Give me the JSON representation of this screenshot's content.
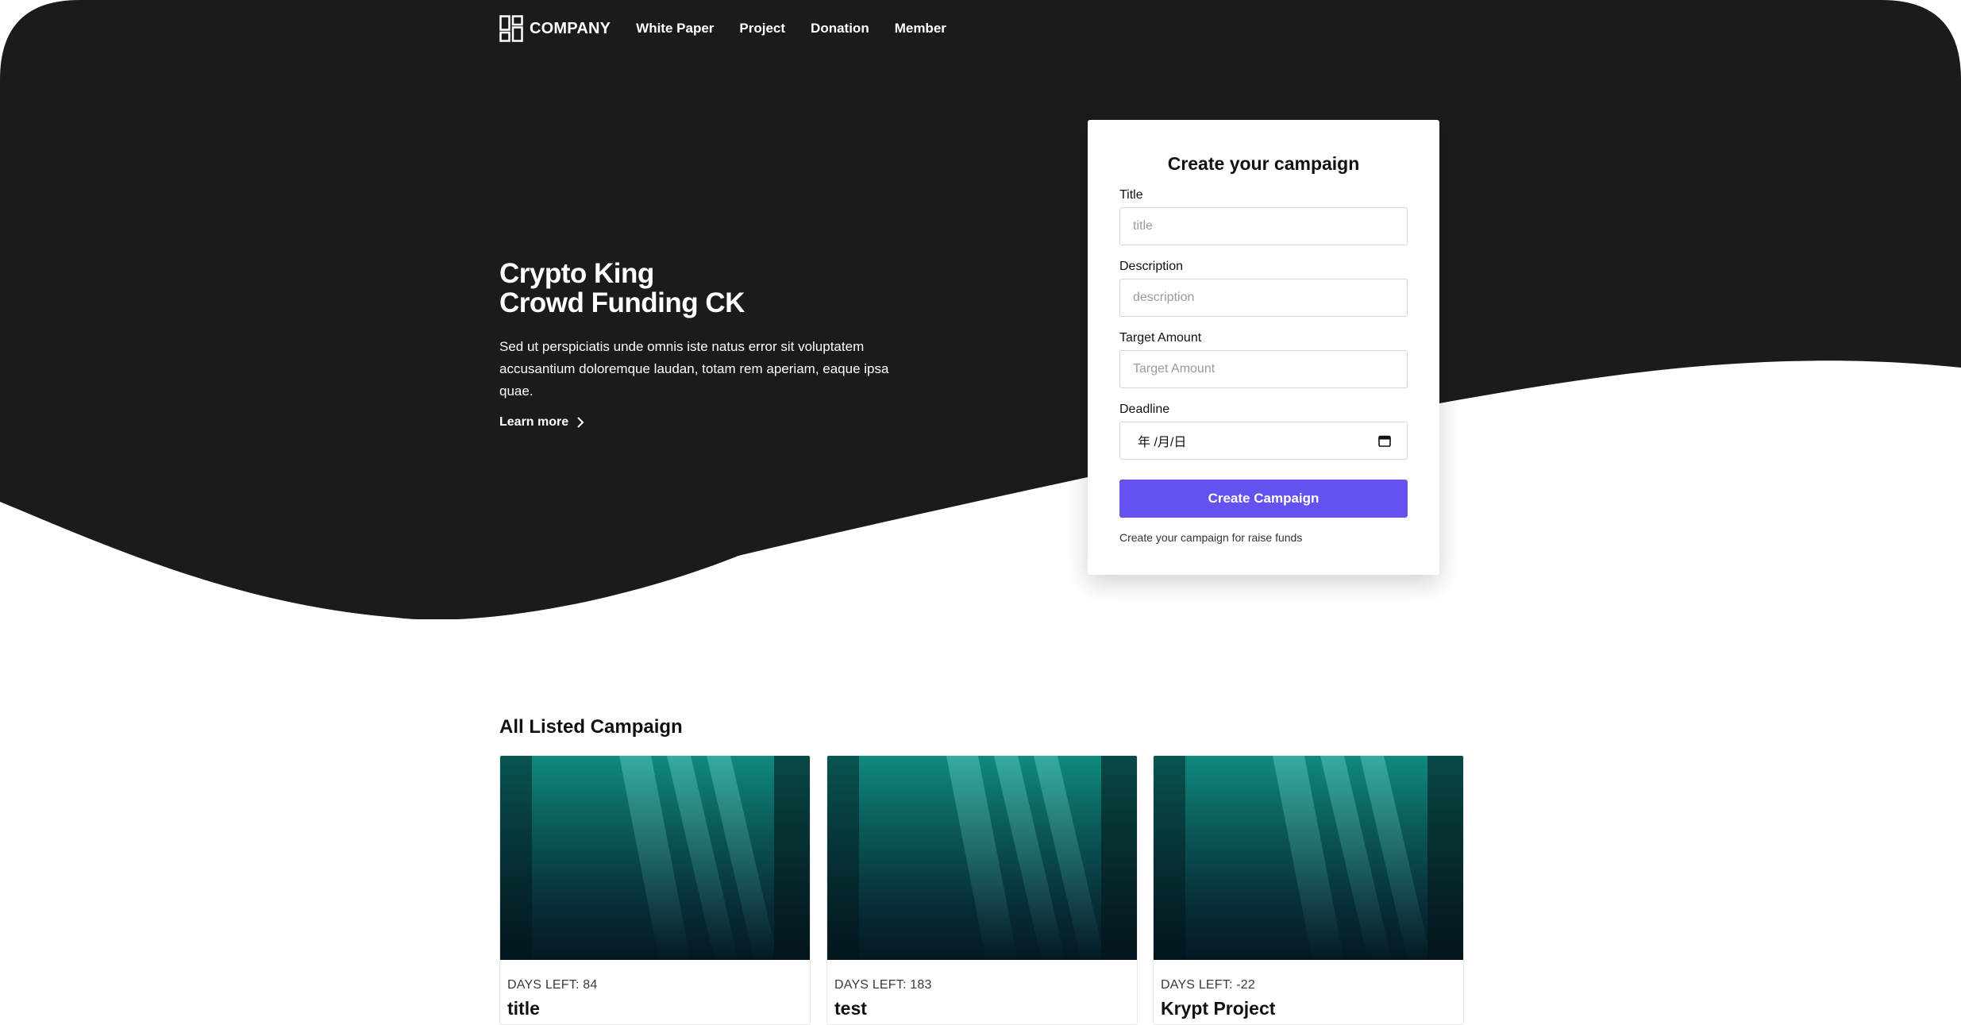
{
  "nav": {
    "logo_text": "COMPANY",
    "links": [
      "White Paper",
      "Project",
      "Donation",
      "Member"
    ]
  },
  "hero": {
    "title_line1": "Crypto King",
    "title_line2": "Crowd Funding CK",
    "description": "Sed ut perspiciatis unde omnis iste natus error sit voluptatem accusantium doloremque laudan, totam rem aperiam, eaque ipsa quae.",
    "learn_more": "Learn more"
  },
  "form": {
    "title": "Create your campaign",
    "fields": {
      "title": {
        "label": "Title",
        "placeholder": "title"
      },
      "description": {
        "label": "Description",
        "placeholder": "description"
      },
      "target": {
        "label": "Target Amount",
        "placeholder": "Target Amount"
      },
      "deadline": {
        "label": "Deadline",
        "value": "年 /月/日"
      }
    },
    "submit_label": "Create Campaign",
    "note": "Create your campaign for raise funds"
  },
  "listing": {
    "title": "All Listed Campaign",
    "cards": [
      {
        "days_left": "DAYS LEFT: 84",
        "title": "title"
      },
      {
        "days_left": "DAYS LEFT: 183",
        "title": "test"
      },
      {
        "days_left": "DAYS LEFT: -22",
        "title": "Krypt Project"
      }
    ]
  },
  "colors": {
    "hero_bg": "#1b1b1b",
    "accent": "#6352f0"
  },
  "icons": {
    "logo": "grid-logo-icon",
    "learn_more": "chevron-right-icon",
    "deadline": "calendar-icon"
  }
}
